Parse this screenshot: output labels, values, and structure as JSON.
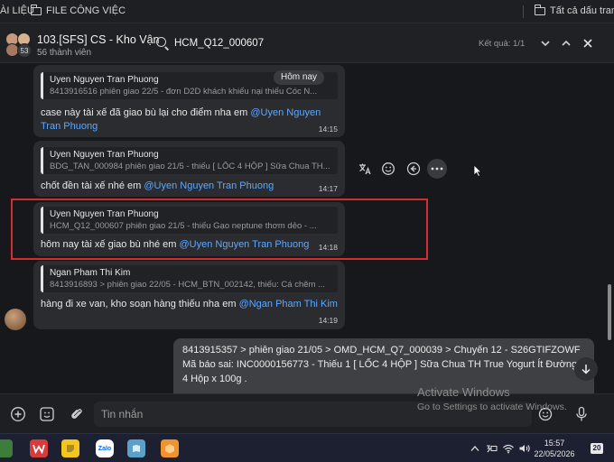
{
  "bookmarks": {
    "items": [
      "ÀI LIỆU",
      "FILE CÔNG VIỆC"
    ],
    "right": "Tất cả dấu trang"
  },
  "header": {
    "group_name": "103.[SFS] CS - Kho Vận",
    "member_count": "56 thành viên",
    "avatar_count": "53",
    "search_value": "HCM_Q12_000607",
    "result_count": "Kết quả: 1/1"
  },
  "date_badge": "Hôm nay",
  "messages": [
    {
      "quote_name": "Uyen Nguyen Tran Phuong",
      "quote_text": "8413916516 phiên giao 22/5 - đơn D2D khách khiếu nại thiếu Cóc N...",
      "text": "case này tài xế đã giao bù lại cho điểm nha em ",
      "mention": "@Uyen Nguyen Tran Phuong",
      "time": "14:15"
    },
    {
      "quote_name": "Uyen Nguyen Tran Phuong",
      "quote_text": "BDG_TAN_000984 phiên giao 21/5 - thiếu [ LỐC 4 HỘP ] Sữa Chua TH...",
      "text": "chốt đền tài xế nhé em ",
      "mention": "@Uyen Nguyen Tran Phuong",
      "time": "14:17"
    },
    {
      "quote_name": "Uyen Nguyen Tran Phuong",
      "quote_text": "HCM_Q12_000607 phiên giao 21/5 - thiếu Gạo neptune thơm dẻo - ...",
      "text": "hôm nay tài xế giao bù nhé em ",
      "mention": "@Uyen Nguyen Tran Phuong",
      "time": "14:18"
    },
    {
      "quote_name": "Ngan Pham Thi Kim",
      "quote_text": "8413916893 > phiên giao 22/05 - HCM_BTN_002142, thiếu: Cá chẽm ...",
      "text": "hàng đi xe van, kho soạn hàng thiếu nha em ",
      "mention": "@Ngan Pham Thi Kim",
      "time": "14:19"
    }
  ],
  "my_message": {
    "line1": "8413915357 > phiên giao 21/05 > OMD_HCM_Q7_000039 > Chuyến 12 - S26GTIFZOWF",
    "line2": "Mã báo sai: INC0000156773 - Thiếu 1 [ LỐC 4 HỘP ] Sữa Chua TH True Yogurt Ít Đường I",
    "line3": "4 Hộp x 100g ."
  },
  "composer": {
    "placeholder": "Tin nhắn"
  },
  "watermark": {
    "title": "Activate Windows",
    "subtitle": "Go to Settings to activate Windows."
  },
  "taskbar": {
    "zalo_label": "Zalo",
    "time": "15:57",
    "date": "22/05/2026",
    "notifications": "20"
  },
  "colors": {
    "accent_link": "#5da8ff",
    "highlight_border": "#d42d2d",
    "bubble": "#2b2c30",
    "own_bubble": "#3f4044"
  }
}
